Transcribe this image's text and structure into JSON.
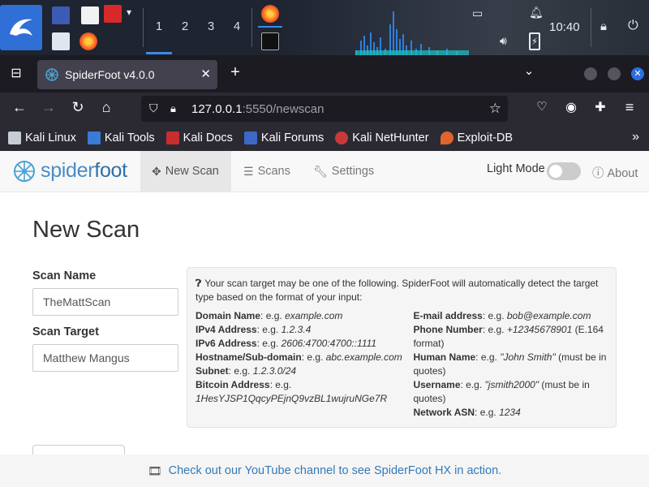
{
  "taskbar": {
    "workspaces": [
      "1",
      "2",
      "3",
      "4"
    ],
    "clock": "10:40"
  },
  "browser": {
    "tab_title": "SpiderFoot v4.0.0",
    "url_host": "127.0.0.1",
    "url_rest": ":5550/newscan",
    "bookmarks": [
      "Kali Linux",
      "Kali Tools",
      "Kali Docs",
      "Kali Forums",
      "Kali NetHunter",
      "Exploit-DB"
    ]
  },
  "app": {
    "brand_part1": "spider",
    "brand_part2": "foot",
    "nav": [
      "New Scan",
      "Scans",
      "Settings"
    ],
    "light_mode_label": "Light Mode",
    "about_label": "About",
    "page_title": "New Scan",
    "scan_name_label": "Scan Name",
    "scan_name_value": "TheMattScan",
    "scan_target_label": "Scan Target",
    "scan_target_value": "Matthew Mangus",
    "help_intro": "Your scan target may be one of the following. SpiderFoot will automatically detect the target type based on the format of your input:",
    "help_left": [
      {
        "name": "Domain Name",
        "sep": ": e.g. ",
        "example": "example.com",
        "note": ""
      },
      {
        "name": "IPv4 Address",
        "sep": ": e.g. ",
        "example": "1.2.3.4",
        "note": ""
      },
      {
        "name": "IPv6 Address",
        "sep": ": e.g. ",
        "example": "2606:4700:4700::1111",
        "note": ""
      },
      {
        "name": "Hostname/Sub-domain",
        "sep": ": e.g. ",
        "example": "abc.example.com",
        "note": ""
      },
      {
        "name": "Subnet",
        "sep": ": e.g. ",
        "example": "1.2.3.0/24",
        "note": ""
      },
      {
        "name": "Bitcoin Address",
        "sep": ": e.g. ",
        "example": "1HesYJSP1QqcyPEjnQ9vzBL1wujruNGe7R",
        "note": ""
      }
    ],
    "help_right": [
      {
        "name": "E-mail address",
        "sep": ": e.g. ",
        "example": "bob@example.com",
        "note": ""
      },
      {
        "name": "Phone Number",
        "sep": ": e.g. ",
        "example": "+12345678901",
        "note": " (E.164 format)"
      },
      {
        "name": "Human Name",
        "sep": ": e.g. ",
        "example": "\"John Smith\"",
        "note": " (must be in quotes)"
      },
      {
        "name": "Username",
        "sep": ": e.g. ",
        "example": "\"jsmith2000\"",
        "note": " (must be in quotes)"
      },
      {
        "name": "Network ASN",
        "sep": ": e.g. ",
        "example": "1234",
        "note": ""
      }
    ],
    "footer_text": "Check out our YouTube channel to see SpiderFoot HX in action."
  }
}
